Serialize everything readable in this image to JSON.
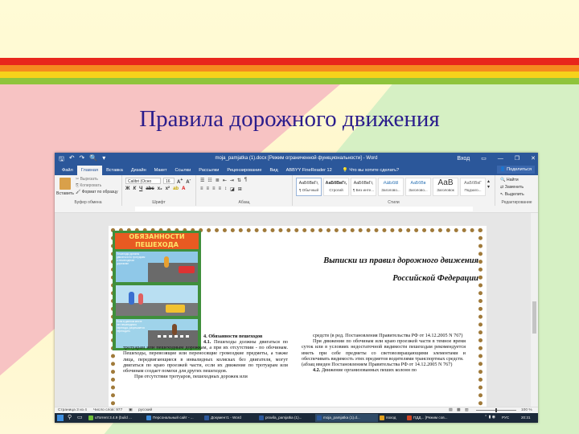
{
  "slide": {
    "title": "Правила дорожного движения",
    "colors": {
      "title": "#2b1d8c",
      "stripe_red": "#e8261c",
      "stripe_orange": "#f58a1f",
      "stripe_yellow": "#f6d21b",
      "stripe_green": "#8fc43c"
    }
  },
  "word": {
    "window_title": "moja_pamjatka (1).docx [Режим ограниченной функциональности] - Word",
    "signin": "Вход",
    "tabs": [
      "Файл",
      "Главная",
      "Вставка",
      "Дизайн",
      "Макет",
      "Ссылки",
      "Рассылки",
      "Рецензирование",
      "Вид",
      "ABBYY FineReader 12"
    ],
    "active_tab": "Главная",
    "tell_me": "Что вы хотите сделать?",
    "share": "Поделиться",
    "ribbon": {
      "clipboard": {
        "paste": "Вставить",
        "cut": "Вырезать",
        "copy": "Копировать",
        "format_painter": "Формат по образцу",
        "label": "Буфер обмена"
      },
      "font": {
        "family": "Calibri (Осно",
        "size": "16",
        "label": "Шрифт"
      },
      "paragraph": {
        "label": "Абзац"
      },
      "styles": {
        "label": "Стили",
        "items": [
          {
            "sample": "АаБбВвГг,",
            "name": "¶ Обычный"
          },
          {
            "sample": "АаБбВвГг,",
            "name": "Строгий"
          },
          {
            "sample": "АаБбВвГг,",
            "name": "¶ Без инте..."
          },
          {
            "sample": "АаБбВ",
            "name": "Заголово..."
          },
          {
            "sample": "АаБбВв",
            "name": "Заголово..."
          },
          {
            "sample": "АаВ",
            "name": "Заголовок"
          },
          {
            "sample": "АаБбВвГ",
            "name": "Подзаго..."
          }
        ]
      },
      "editing": {
        "find": "Найти",
        "replace": "Заменить",
        "select": "Выделить",
        "label": "Редактирование"
      }
    },
    "document": {
      "poster_title": "ОБЯЗАННОСТИ ПЕШЕХОДА",
      "poster_text_1": "Пешеходы должны двигаться по тротуарам и пешеходным дорожкам",
      "poster_text_2": "Если в данном месте нет пешеходного перехода, разрешается переходить",
      "title_line1": "Выписки из правил дорожного движения",
      "title_line2": "Российской Федерации",
      "section": "4. Обязанности пешеходов",
      "col_left": [
        {
          "lead": "4.1.",
          "text": "Пешеходы должны двигаться по тротуарам или пешеходным дорожкам, а при их отсутствии - по обочинам. Пешеходы, перевозящие или переносящие громоздкие предметы, а также лица, передвигающиеся в инвалидных колясках без двигателя, могут двигаться по краю проезжей части, если их движение по тротуарам или обочинам создает помехи для других пешеходов."
        },
        {
          "lead": "",
          "text": "При отсутствии тротуаров, пешеходных дорожек или"
        }
      ],
      "col_right": [
        {
          "lead": "",
          "text": "средств (в ред. Постановления Правительства РФ от 14.12.2005 N 767)"
        },
        {
          "lead": "",
          "text": "При движении по обочинам или краю проезжей части в темное время суток или в условиях недостаточной видимости пешеходам рекомендуется иметь при себе предметы со световозвращающими элементами и обеспечивать видимость этих предметов водителями транспортных средств."
        },
        {
          "lead": "",
          "text": "(абзац введен Постановлением Правительства РФ от 14.12.2005 N 767)"
        },
        {
          "lead": "4.2.",
          "text": "Движение организованных пеших колонн по"
        }
      ]
    },
    "status": {
      "page": "Страница 3 из 4",
      "words": "Число слов: 977",
      "lang": "русский",
      "zoom": "100 %"
    }
  },
  "taskbar": {
    "items": [
      {
        "label": "uTorrent 3.4.9 (build ...",
        "color": "#6fbf3a"
      },
      {
        "label": "Персональный сайт - ...",
        "color": "#3b8ad9"
      },
      {
        "label": "Документ1 - Word",
        "color": "#2b579a"
      },
      {
        "label": "pravila_pamjatka (1)...",
        "color": "#2b579a"
      },
      {
        "label": "moja_pamjatka (1).d...",
        "color": "#2b579a"
      },
      {
        "label": "поход",
        "color": "#e0a020"
      },
      {
        "label": "ПДД... [Режим сов...",
        "color": "#d04525"
      }
    ],
    "lang": "РУС",
    "time": "20:31"
  }
}
